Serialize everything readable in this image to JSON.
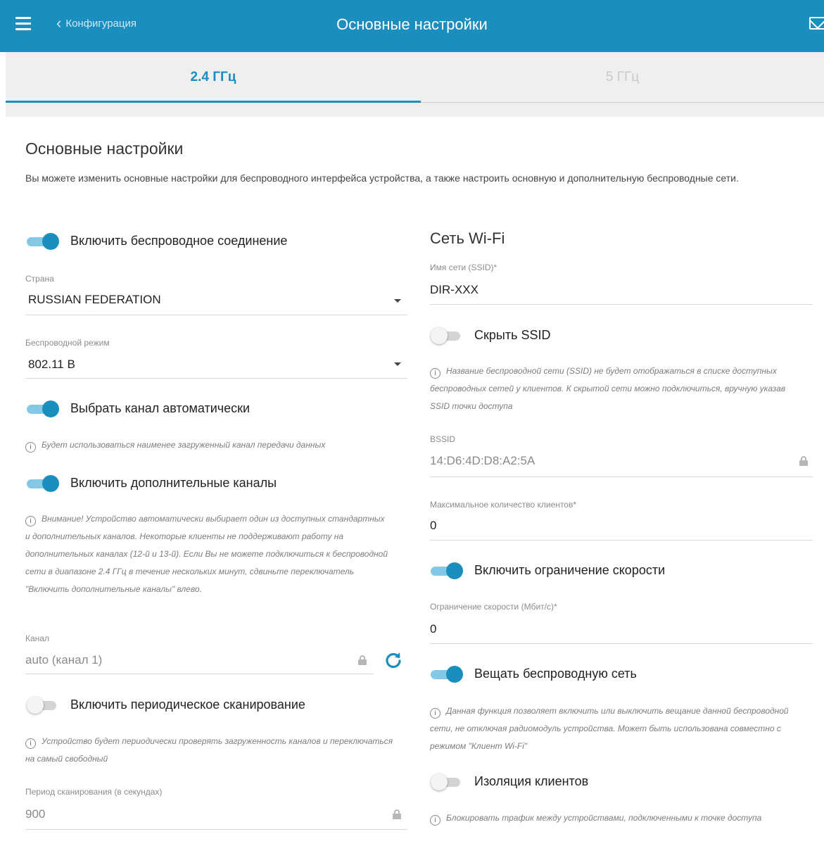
{
  "header": {
    "back_label": "Конфигурация",
    "title": "Основные настройки",
    "color": "#1b8ec0"
  },
  "tabs": [
    {
      "label": "2.4 ГГц",
      "active": true
    },
    {
      "label": "5 ГГц",
      "active": false
    }
  ],
  "main": {
    "title": "Основные настройки",
    "description": "Вы можете изменить основные настройки для беспроводного интерфейса устройства, а также настроить основную и дополнительную беспроводные сети."
  },
  "left": {
    "enable_wireless": {
      "label": "Включить беспроводное соединение",
      "on": true
    },
    "country": {
      "label": "Страна",
      "value": "RUSSIAN FEDERATION"
    },
    "wireless_mode": {
      "label": "Беспроводной режим",
      "value": "802.11 B"
    },
    "auto_channel": {
      "label": "Выбрать канал автоматически",
      "on": true
    },
    "auto_channel_info": "Будет использоваться наименее загруженный канал передачи данных",
    "extra_channels": {
      "label": "Включить дополнительные каналы",
      "on": true
    },
    "extra_channels_info": "Внимание! Устройство автоматически выбирает один из доступных стандартных и дополнительных каналов. Некоторые клиенты не поддерживают работу на дополнительных каналах (12-й и 13-й). Если Вы не можете подключиться к беспроводной сети в диапазоне 2.4 ГГц в течение нескольких минут, сдвиньте переключатель \"Включить дополнительные каналы\" влево.",
    "channel": {
      "label": "Канал",
      "value": "auto (канал 1)"
    },
    "periodic_scan": {
      "label": "Включить периодическое сканирование",
      "on": false
    },
    "periodic_scan_info": "Устройство будет периодически проверять загруженность каналов и переключаться на самый свободный",
    "scan_period": {
      "label": "Период сканирования (в секундах)",
      "value": "900"
    }
  },
  "right": {
    "title": "Сеть Wi-Fi",
    "ssid": {
      "label": "Имя сети (SSID)*",
      "value": "DIR-XXX"
    },
    "hide_ssid": {
      "label": "Скрыть SSID",
      "on": false
    },
    "hide_ssid_info": "Название беспроводной сети (SSID) не будет отображаться в списке доступных беспроводных сетей у клиентов. К скрытой сети можно подключиться, вручную указав SSID точки доступа",
    "bssid": {
      "label": "BSSID",
      "value": "14:D6:4D:D8:A2:5A"
    },
    "max_clients": {
      "label": "Максимальное количество клиентов*",
      "value": "0"
    },
    "speed_limit_toggle": {
      "label": "Включить ограничение скорости",
      "on": true
    },
    "speed_limit": {
      "label": "Ограничение скорости (Мбит/с)*",
      "value": "0"
    },
    "broadcast": {
      "label": "Вещать беспроводную сеть",
      "on": true
    },
    "broadcast_info": "Данная функция позволяет включить или выключить вещание данной беспроводной сети, не отключая радиомодуль устройства. Может быть использована совместно с режимом \"Клиент Wi-Fi\"",
    "client_isolation": {
      "label": "Изоляция клиентов",
      "on": false
    },
    "client_isolation_info": "Блокировать трафик между устройствами, подключенными к точке доступа"
  },
  "icons": {
    "menu": "hamburger-icon",
    "back": "chevron-left-icon",
    "mail": "mail-icon",
    "lock": "lock-icon",
    "refresh": "refresh-icon",
    "info": "info-icon"
  }
}
